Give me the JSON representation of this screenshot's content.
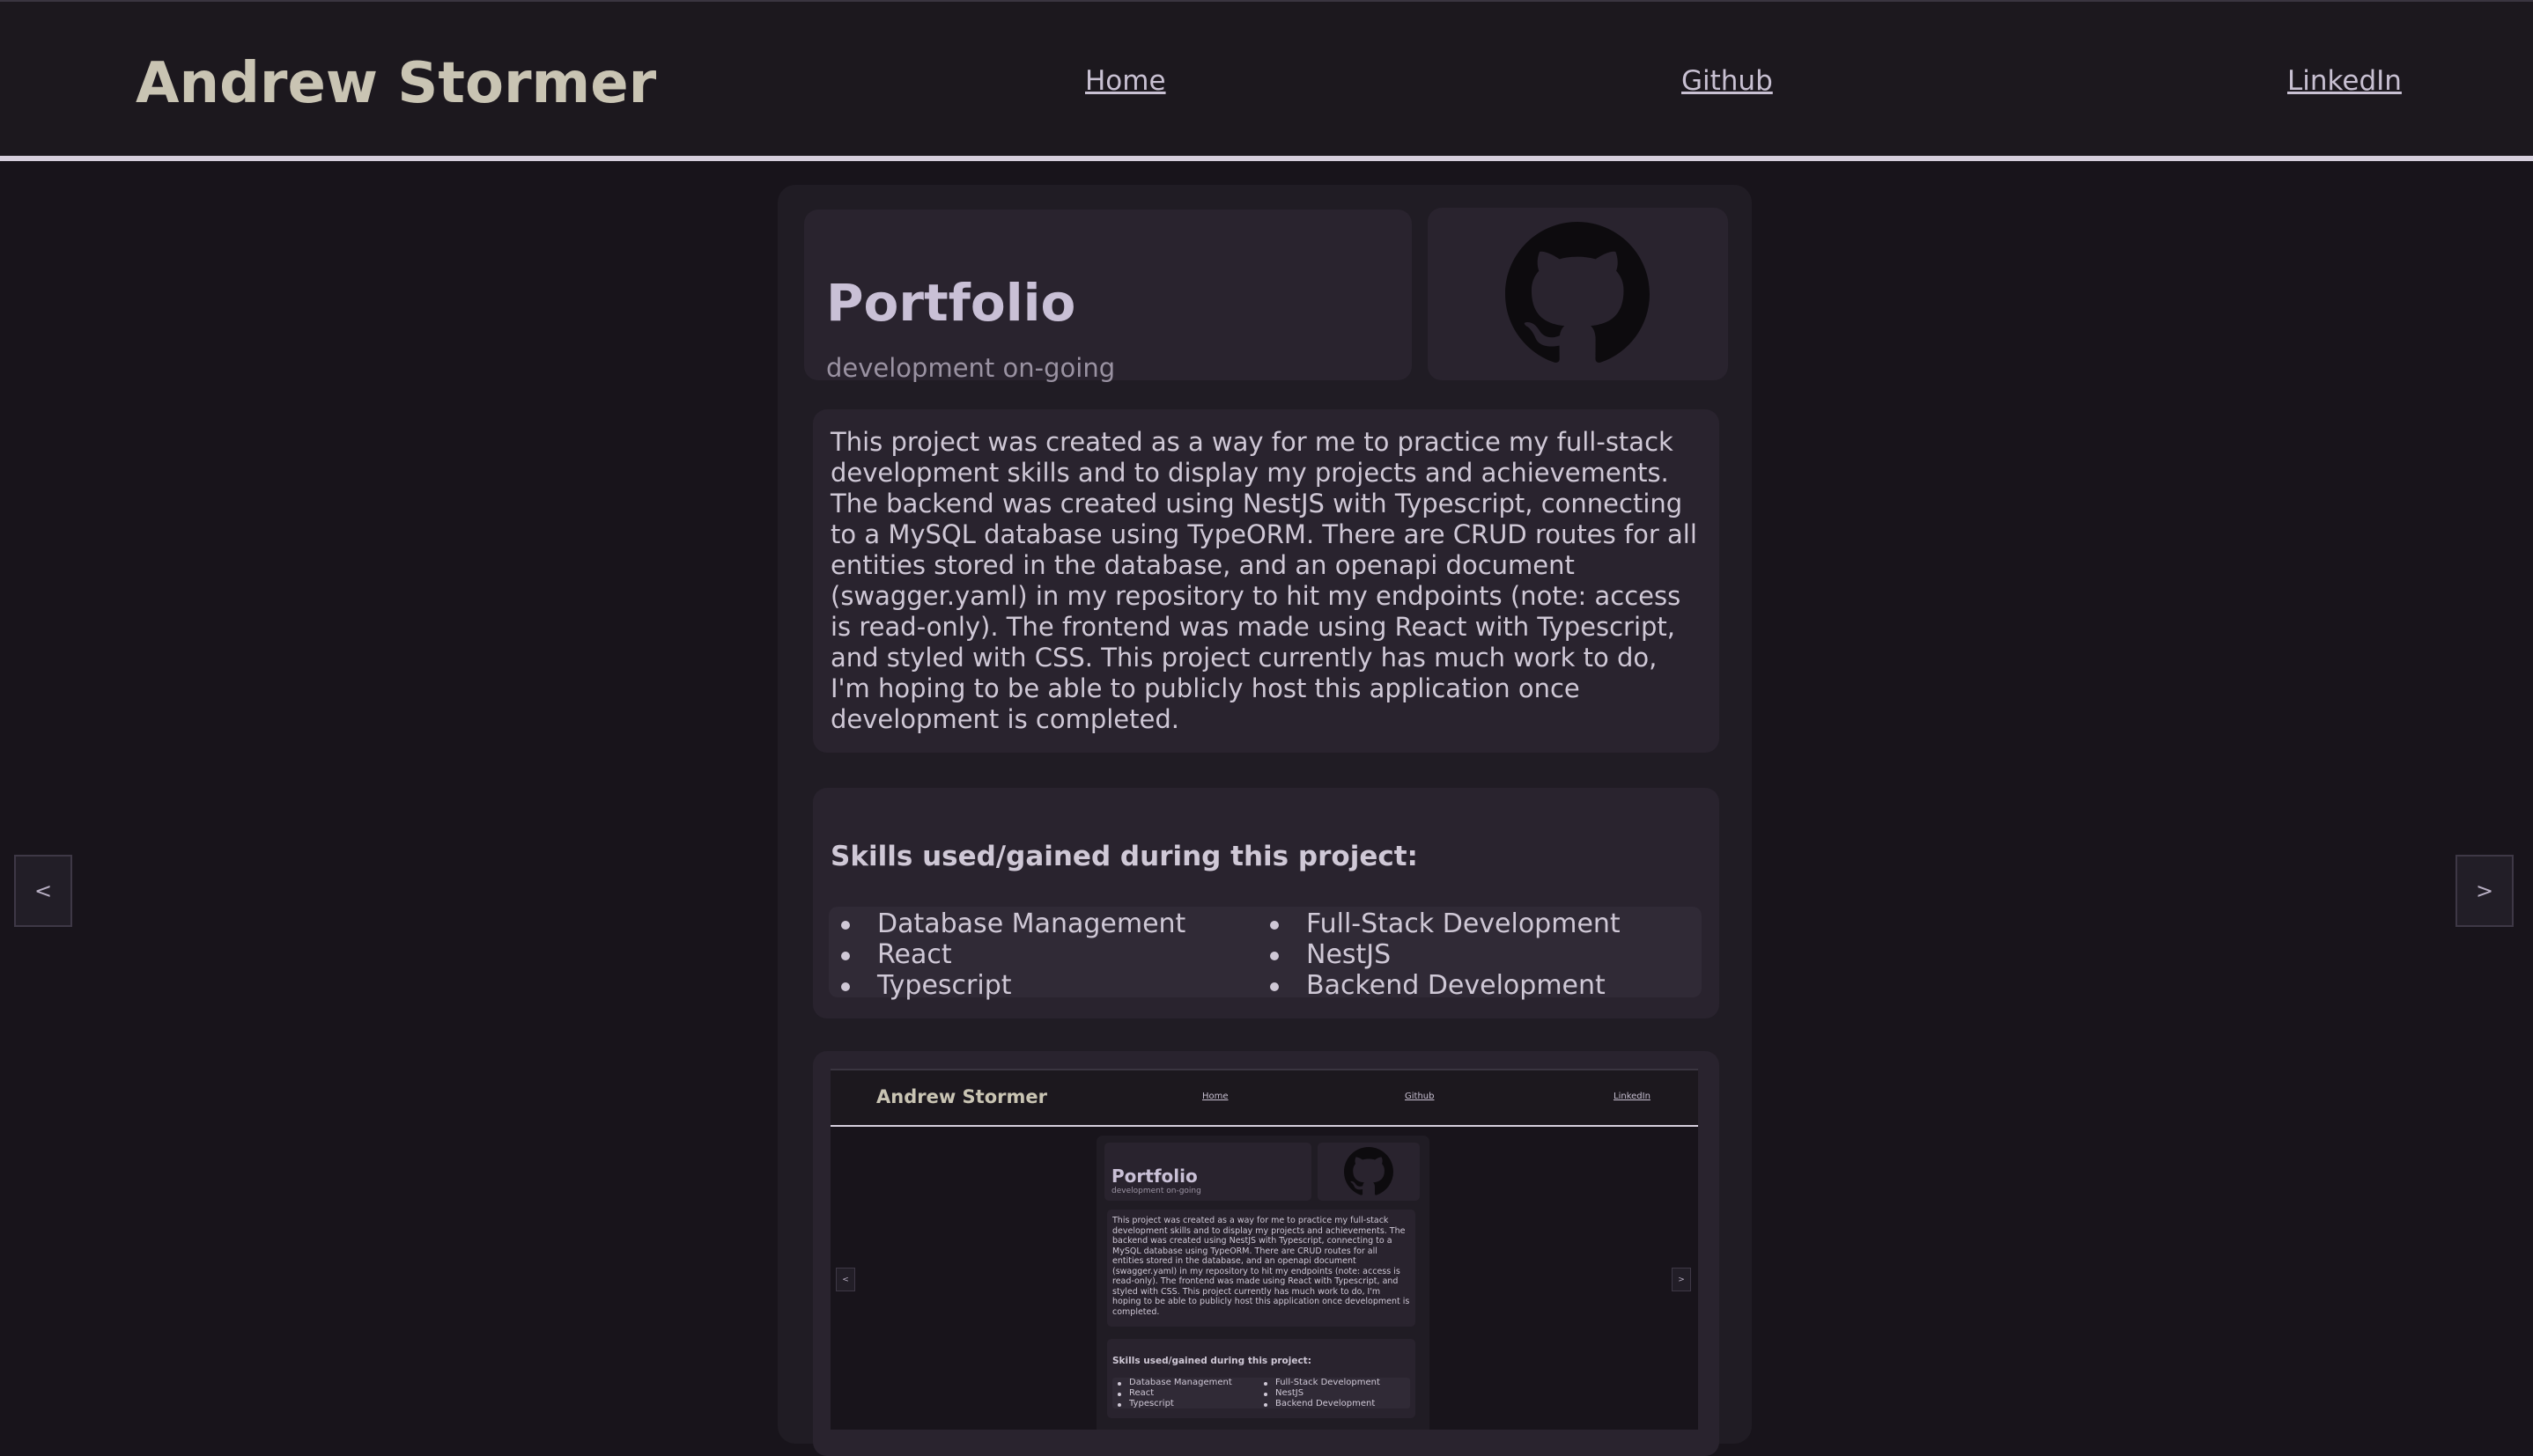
{
  "header": {
    "brand": "Andrew Stormer",
    "nav": [
      {
        "label": "Home"
      },
      {
        "label": "Github"
      },
      {
        "label": "LinkedIn"
      }
    ]
  },
  "project": {
    "title": "Portfolio",
    "subtitle": "development on-going",
    "icon": "github-icon",
    "description": "This project was created as a way for me to practice my full-stack development skills and to display my projects and achievements. The backend was created using NestJS with Typescript, connecting to a MySQL database using TypeORM. There are CRUD routes for all entities stored in the database, and an openapi document (swagger.yaml) in my repository to hit my endpoints (note: access is read-only). The frontend was made using React with Typescript, and styled with CSS. This project currently has much work to do, I'm hoping to be able to publicly host this application once development is completed.",
    "skills_heading": "Skills used/gained during this project:",
    "skills": [
      "Database Management",
      "React",
      "Typescript",
      "Full-Stack Development",
      "NestJS",
      "Backend Development"
    ]
  },
  "carousel": {
    "prev_label": "<",
    "next_label": ">"
  },
  "colors": {
    "background": "#18141b",
    "header_bg": "#1c181e",
    "card_bg": "#201c24",
    "panel_bg": "#29232e",
    "brand_text": "#c9c4b3",
    "accent_rule": "#d6cfdd"
  }
}
